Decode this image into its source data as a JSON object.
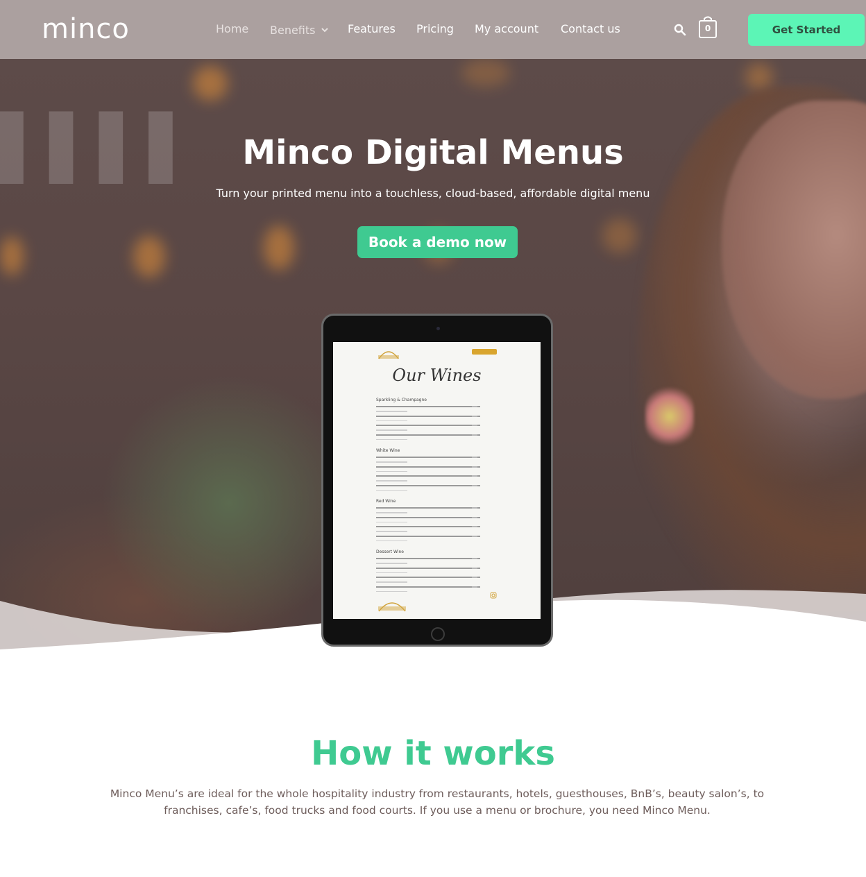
{
  "brand": {
    "logo_text": "minco"
  },
  "nav": {
    "home": "Home",
    "benefits": "Benefits",
    "features": "Features",
    "pricing": "Pricing",
    "my_account": "My account",
    "contact": "Contact us"
  },
  "header": {
    "cart_count": "0",
    "cta_label": "Get Started"
  },
  "hero": {
    "title": "Minco Digital Menus",
    "subtitle": "Turn your printed menu into a touchless, cloud-based, affordable digital menu",
    "button_label": "Book a demo now"
  },
  "tablet_menu": {
    "title": "Our Wines",
    "sections": [
      "Sparkling & Champagne",
      "White Wine",
      "Red Wine",
      "Dessert Wine"
    ]
  },
  "how_it_works": {
    "title": "How it works",
    "body": "Minco Menu’s are ideal for the whole hospitality industry from restaurants, hotels, guesthouses, BnB’s, beauty salon’s,  to franchises, cafe’s, food trucks and food courts. If you use a menu or brochure, you need Minco Menu."
  },
  "colors": {
    "header_bg": "#aba09f",
    "cta_green": "#5cf5b6",
    "hero_button": "#3fca91",
    "heading_green": "#3fca91",
    "body_text": "#6d5c5a"
  },
  "icons": {
    "search": "search-icon",
    "cart": "shopping-bag-icon",
    "dropdown": "chevron-down-icon"
  }
}
